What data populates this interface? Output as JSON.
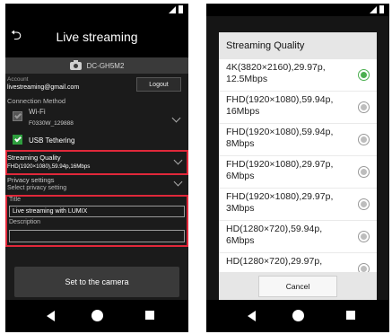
{
  "left_screen": {
    "header": {
      "back_glyph": "⮌",
      "title": "Live streaming"
    },
    "camera": {
      "icon": "camera-icon",
      "name": "DC-GH5M2"
    },
    "account": {
      "label": "Account",
      "value": "livestreaming@gmail.com",
      "logout_label": "Logout"
    },
    "connection": {
      "label": "Connection Method",
      "wifi": {
        "label": "Wi-Fi",
        "ssid": "F0330W_129888",
        "checked": false
      },
      "usb": {
        "label": "USB Tethering",
        "checked": true
      }
    },
    "quality": {
      "label": "Streaming Quality",
      "value": "FHD(1920×1080),59.94p,16Mbps"
    },
    "privacy": {
      "label": "Privacy settings",
      "value": "Select privacy setting"
    },
    "title_field": {
      "label": "Title",
      "value": "Live streaming with LUMIX"
    },
    "description_field": {
      "label": "Description",
      "value": ""
    },
    "set_button_label": "Set to the camera",
    "highlight_color": "#e0283a"
  },
  "right_screen": {
    "dialog_title": "Streaming Quality",
    "options": [
      {
        "label": "4K(3820×2160),29.97p, 12.5Mbps",
        "selected": true
      },
      {
        "label": "FHD(1920×1080),59.94p, 16Mbps",
        "selected": false
      },
      {
        "label": "FHD(1920×1080),59.94p, 8Mbps",
        "selected": false
      },
      {
        "label": "FHD(1920×1080),29.97p, 6Mbps",
        "selected": false
      },
      {
        "label": "FHD(1920×1080),29.97p, 3Mbps",
        "selected": false
      },
      {
        "label": "HD(1280×720),59.94p, 6Mbps",
        "selected": false
      },
      {
        "label": "HD(1280×720),29.97p,",
        "selected": false
      }
    ],
    "cancel_label": "Cancel",
    "selected_color": "#4caf50"
  },
  "navbar": {
    "icons": [
      "back-icon",
      "home-icon",
      "recent-apps-icon"
    ]
  }
}
